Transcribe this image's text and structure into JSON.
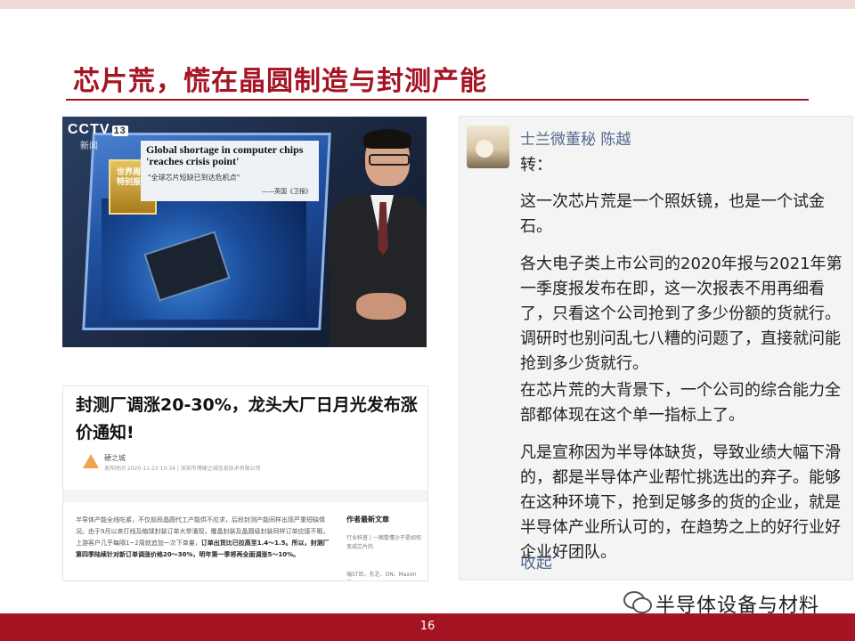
{
  "slide": {
    "title": "芯片荒，慌在晶圆制造与封测产能",
    "page_number": "16"
  },
  "news_image": {
    "channel_logo": "CCTV",
    "channel_number": "13",
    "channel_label": "新闻",
    "badge_text": "世界周刊 特别报道",
    "headline_en": "Global shortage in computer chips 'reaches crisis point'",
    "subtitle_cn": "\"全球芯片短缺已到达危机点\"",
    "source": "——英国《卫报》"
  },
  "article": {
    "headline": "封测厂调涨20-30%，龙头大厂日月光发布涨价通知!",
    "author": "硬之城",
    "meta": "发布时间 2020-11-23 10:34 | 深圳市博硬之城信息技术有限公司",
    "body_intro": "半导体产能全线吃紧，不仅前段晶圆代工产能供不应求，后段封测产能同样出现严重短缺情况。由于9月以来打线及植球封装订单大举涌现，覆晶封装及晶圆级封装同样订单应接不暇，上游客户几乎每隔1~2周就追加一次下单量，",
    "body_bold": "订单出货比已拉高至1.4～1.5。所以，封测厂第四季陆续针对新订单调涨价格20～30%，明年第一季将再全面调涨5～10%。",
    "sidebar_heading": "作者最新文章",
    "sidebar_item_1": "行业科普 | 一图看懂沙子是如何变成芯片的",
    "sidebar_item_2": "瑞ST后，东芝、ON、Maxim也"
  },
  "post": {
    "author_name": "士兰微董秘 陈越",
    "forward_label": "转：",
    "paragraphs": [
      "这一次芯片荒是一个照妖镜，也是一个试金石。",
      "各大电子类上市公司的2020年报与2021年第一季度报发布在即，这一次报表不用再细看了，只看这个公司抢到了多少份额的货就行。调研时也别问乱七八糟的问题了，直接就问能抢到多少货就行。",
      "在芯片荒的大背景下，一个公司的综合能力全部都体现在这个单一指标上了。",
      "凡是宣称因为半导体缺货，导致业绩大幅下滑的，都是半导体产业帮忙挑选出的弃子。能够在这种环境下，抢到足够多的货的企业，就是半导体产业所认可的，在趋势之上的好行业好企业好团队。"
    ],
    "collapse_label": "收起"
  },
  "watermark": {
    "icon": "wechat-icon",
    "text": "半导体设备与材料"
  },
  "colors": {
    "accent": "#a51423",
    "link": "#556a8f"
  }
}
